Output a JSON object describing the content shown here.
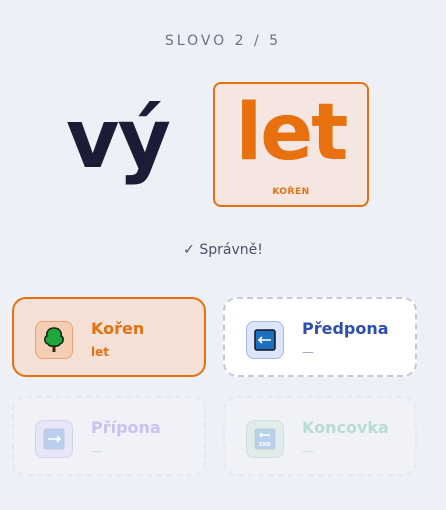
{
  "header": {
    "counter": "SLOVO 2 / 5"
  },
  "word": {
    "prefix": "vý",
    "root": "let",
    "root_label": "KOŘEN"
  },
  "feedback": "✓ Správně!",
  "cards": [
    {
      "title": "Kořen",
      "value": "let",
      "icon": "tree-icon"
    },
    {
      "title": "Předpona",
      "value": "—",
      "icon": "arrow-left-icon"
    },
    {
      "title": "Přípona",
      "value": "—",
      "icon": "arrow-right-icon"
    },
    {
      "title": "Koncovka",
      "value": "—",
      "icon": "end-icon"
    }
  ],
  "colors": {
    "accent": "#e8700f",
    "prefix_card": "#2d4fb5",
    "text_dark": "#1b1d36"
  }
}
